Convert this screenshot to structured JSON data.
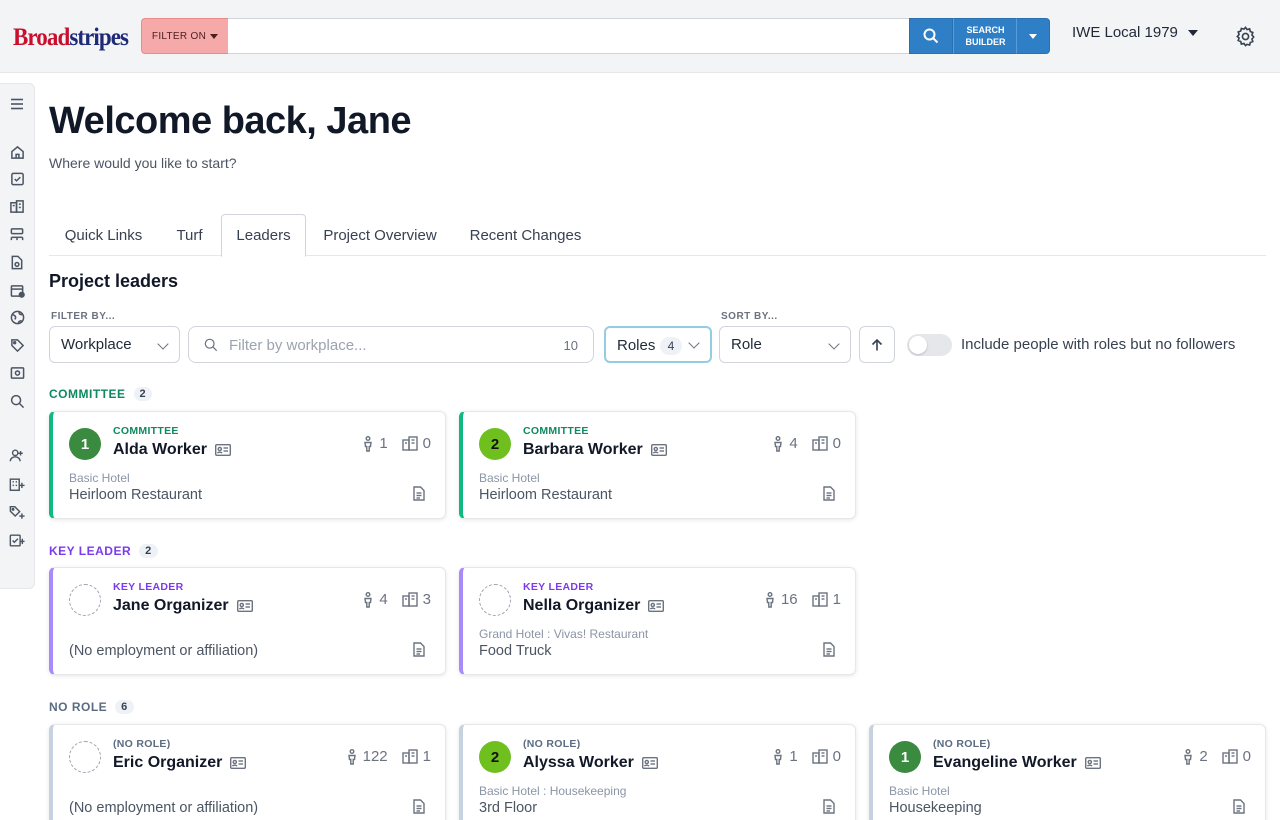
{
  "header": {
    "logo_part1": "Broad",
    "logo_part2": "stripes",
    "filter_label": "FILTER ON",
    "search_value": "",
    "search_builder_line1": "SEARCH",
    "search_builder_line2": "BUILDER",
    "org_name": "IWE Local 1979"
  },
  "sidebar": {
    "icons": [
      "menu-icon",
      "home-icon",
      "tasks-icon",
      "buildings-icon",
      "org-chart-icon",
      "document-icon",
      "calendar-icon",
      "globe-icon",
      "tag-icon",
      "id-card-icon",
      "search-icon",
      "add-person-icon",
      "add-building-icon",
      "add-tag-icon",
      "add-task-icon"
    ]
  },
  "main": {
    "welcome": "Welcome back, Jane",
    "subtitle": "Where would you like to start?",
    "tabs": [
      {
        "label": "Quick Links",
        "active": false
      },
      {
        "label": "Turf",
        "active": false
      },
      {
        "label": "Leaders",
        "active": true
      },
      {
        "label": "Project Overview",
        "active": false
      },
      {
        "label": "Recent Changes",
        "active": false
      }
    ],
    "section_title": "Project leaders"
  },
  "filters": {
    "filter_by_label": "FILTER BY...",
    "filter_type_value": "Workplace",
    "filter_placeholder": "Filter by workplace...",
    "filter_count": "10",
    "roles_label": "Roles",
    "roles_count": "4",
    "sort_by_label": "SORT BY...",
    "sort_value": "Role",
    "toggle_label": "Include people with roles but no followers",
    "toggle_on": false
  },
  "groups": [
    {
      "title": "COMMITTEE",
      "count": "2",
      "color": "#0f8a5f"
    },
    {
      "title": "KEY LEADER",
      "count": "2",
      "color": "#7c3aed"
    },
    {
      "title": "NO ROLE",
      "count": "6",
      "color": "#5b6b82"
    }
  ],
  "cards": [
    {
      "role": "COMMITTEE",
      "name": "Alda Worker",
      "avatar": "1",
      "followers": "1",
      "workplaces": "0",
      "emp_top": "Basic Hotel",
      "emp_main": "Heirloom Restaurant"
    },
    {
      "role": "COMMITTEE",
      "name": "Barbara Worker",
      "avatar": "2",
      "followers": "4",
      "workplaces": "0",
      "emp_top": "Basic Hotel",
      "emp_main": "Heirloom Restaurant"
    },
    {
      "role": "KEY LEADER",
      "name": "Jane Organizer",
      "avatar": "",
      "followers": "4",
      "workplaces": "3",
      "emp_top": "",
      "emp_main": "(No employment or affiliation)"
    },
    {
      "role": "KEY LEADER",
      "name": "Nella Organizer",
      "avatar": "",
      "followers": "16",
      "workplaces": "1",
      "emp_top": "Grand Hotel : Vivas! Restaurant",
      "emp_main": "Food Truck"
    },
    {
      "role": "(NO ROLE)",
      "name": "Eric Organizer",
      "avatar": "",
      "followers": "122",
      "workplaces": "1",
      "emp_top": "",
      "emp_main": "(No employment or affiliation)"
    },
    {
      "role": "(NO ROLE)",
      "name": "Alyssa Worker",
      "avatar": "2",
      "followers": "1",
      "workplaces": "0",
      "emp_top": "Basic Hotel : Housekeeping",
      "emp_main": "3rd Floor"
    },
    {
      "role": "(NO ROLE)",
      "name": "Evangeline Worker",
      "avatar": "1",
      "followers": "2",
      "workplaces": "0",
      "emp_top": "Basic Hotel",
      "emp_main": "Housekeeping"
    }
  ],
  "colors": {
    "committee": "#0f8a5f",
    "key_leader": "#7c3aed",
    "no_role": "#5b6b82",
    "accent_blue": "#2f7fc6",
    "filter_pink": "#f6a9a9"
  }
}
